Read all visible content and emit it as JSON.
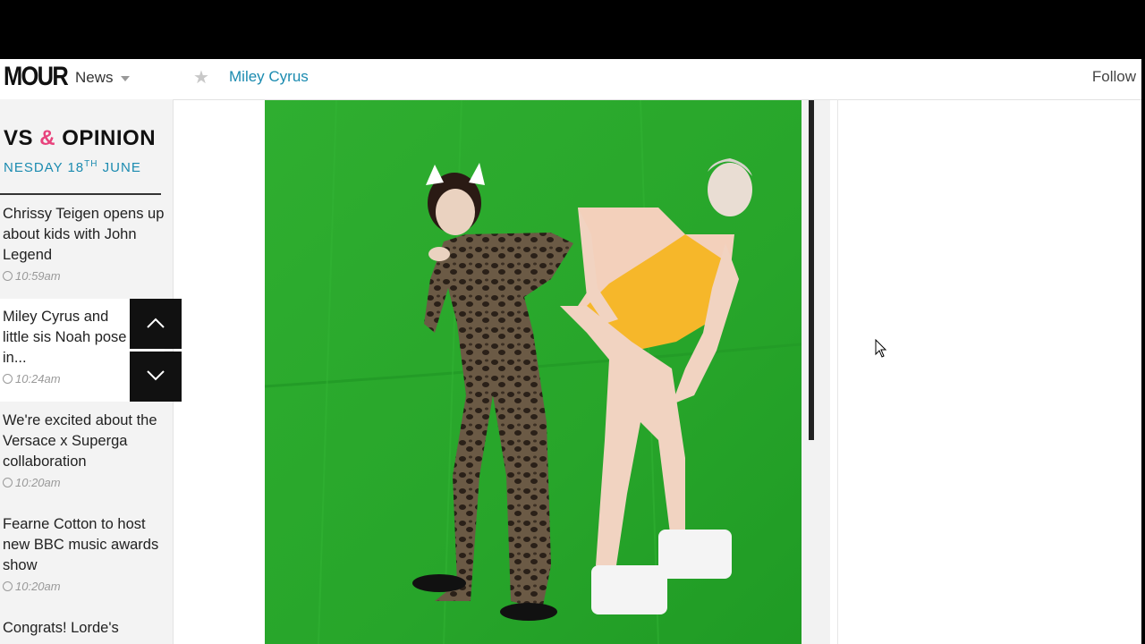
{
  "header": {
    "logo": "MOUR",
    "nav_news": "News",
    "topic": "Miley Cyrus",
    "follow": "Follow"
  },
  "sidebar": {
    "title_left": "VS",
    "title_amp": "&",
    "title_right": "OPINION",
    "date_main": "NESDAY 18",
    "date_sup": "TH",
    "date_end": " JUNE",
    "stories": [
      {
        "headline": "Chrissy Teigen opens up about kids with John Legend",
        "time": "10:59am"
      },
      {
        "headline": "Miley Cyrus and little sis Noah pose in...",
        "time": "10:24am"
      },
      {
        "headline": "We're excited about the Versace x Superga collaboration",
        "time": "10:20am"
      },
      {
        "headline": "Fearne Cotton to host new BBC music awards show",
        "time": "10:20am"
      },
      {
        "headline": "Congrats! Lorde's",
        "time": ""
      }
    ]
  },
  "colors": {
    "accent": "#1b8bb0",
    "amp": "#e8427c",
    "green_screen": "#2dab2e"
  },
  "icons": {
    "star": "star-icon",
    "up": "chevron-up-icon",
    "down": "chevron-down-icon"
  }
}
